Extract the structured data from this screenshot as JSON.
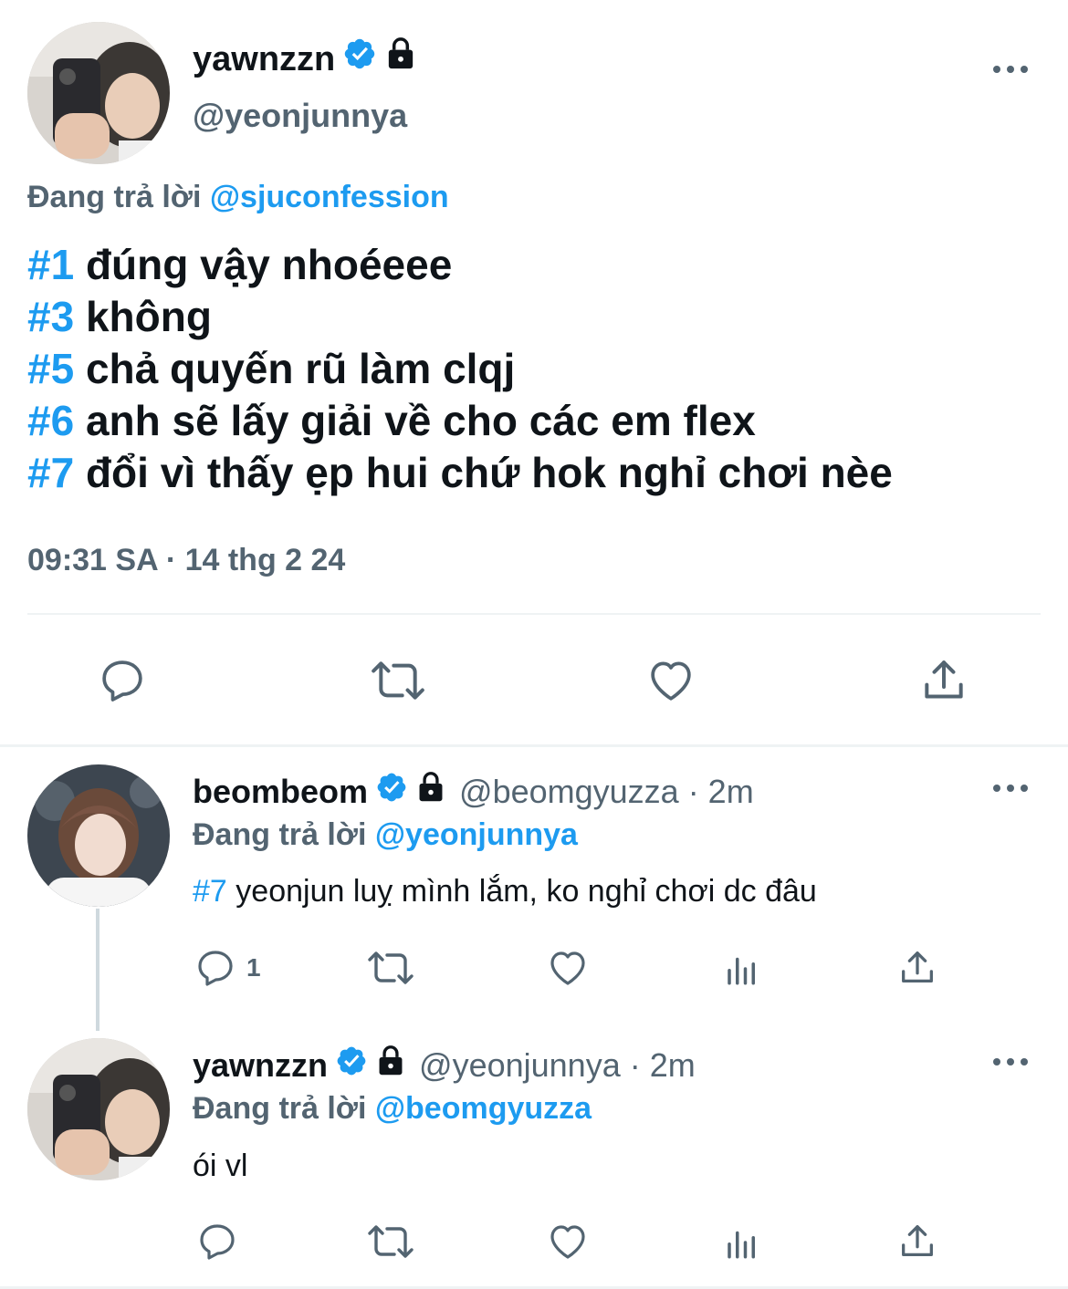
{
  "main_tweet": {
    "display_name": "yawnzzn",
    "handle": "@yeonjunnya",
    "replying_prefix": "Đang trả lời",
    "replying_to": "@sjuconfession",
    "lines": [
      {
        "tag": "#1",
        "text": "đúng vậy nhoéeee"
      },
      {
        "tag": "#3",
        "text": "không"
      },
      {
        "tag": "#5",
        "text": "chả quyến rũ làm clqj"
      },
      {
        "tag": "#6",
        "text": "anh sẽ lấy giải về cho các em flex"
      },
      {
        "tag": "#7",
        "text": "đổi vì thấy ẹp hui chứ hok nghỉ chơi nèe"
      }
    ],
    "timestamp": "09:31 SA · 14 thg 2 24"
  },
  "reply1": {
    "display_name": "beombeom",
    "handle_time": "@beomgyuzza · 2m",
    "replying_prefix": "Đang trả lời",
    "replying_to": "@yeonjunnya",
    "tag": "#7",
    "text": "yeonjun luỵ mình lắm, ko nghỉ chơi dc đâu",
    "reply_count": "1"
  },
  "reply2": {
    "display_name": "yawnzzn",
    "handle_time": "@yeonjunnya · 2m",
    "replying_prefix": "Đang trả lời",
    "replying_to": "@beomgyuzza",
    "text": "ói vl"
  },
  "icons": {
    "verified": "verified-badge-icon",
    "protected": "lock-icon",
    "more": "more-dots-icon",
    "reply": "reply-bubble-icon",
    "retweet": "retweet-icon",
    "like": "heart-icon",
    "views": "views-chart-icon",
    "share": "share-icon"
  },
  "colors": {
    "accent": "#1d9bf0",
    "secondary_text": "#536471",
    "primary_text": "#0f1419",
    "divider": "#eff3f4"
  }
}
